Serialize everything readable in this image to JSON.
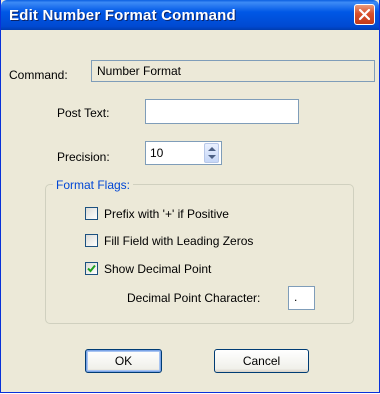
{
  "window": {
    "title": "Edit Number Format Command"
  },
  "command": {
    "label": "Command:",
    "value": "Number Format"
  },
  "post_text": {
    "label": "Post Text:",
    "value": ""
  },
  "precision": {
    "label": "Precision:",
    "value": "10"
  },
  "format_flags": {
    "legend": "Format Flags:",
    "prefix_plus": {
      "label": "Prefix with '+' if Positive",
      "checked": false
    },
    "leading_zeros": {
      "label": "Fill Field with Leading Zeros",
      "checked": false
    },
    "show_decimal": {
      "label": "Show Decimal Point",
      "checked": true
    },
    "decimal_char": {
      "label": "Decimal Point Character:",
      "value": "."
    }
  },
  "buttons": {
    "ok": "OK",
    "cancel": "Cancel"
  },
  "colors": {
    "title_bar": "#0058e6",
    "dialog_bg": "#ece9d8",
    "group_legend": "#0046d5",
    "check": "#21a121"
  }
}
